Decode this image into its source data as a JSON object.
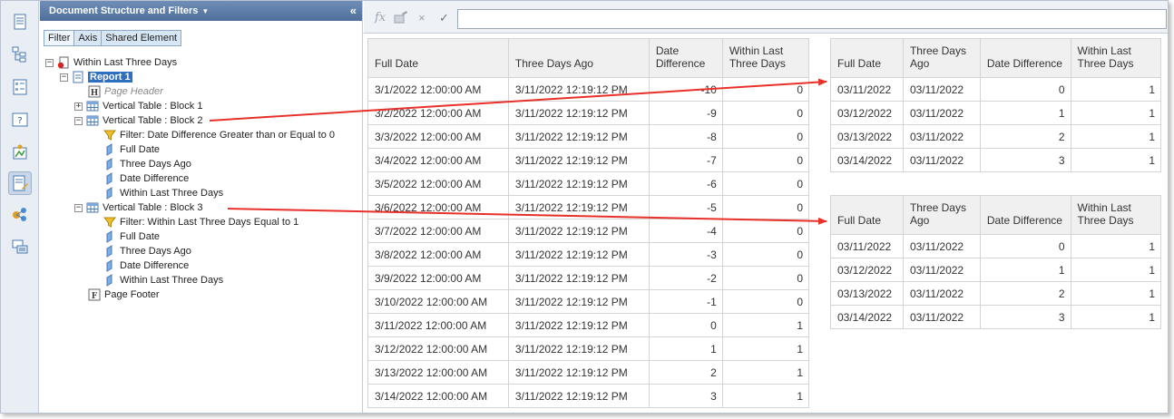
{
  "panel": {
    "title": "Document Structure and Filters",
    "collapse_glyph": "«",
    "tabs": [
      {
        "label": "Filter"
      },
      {
        "label": "Axis"
      },
      {
        "label": "Shared Element"
      }
    ]
  },
  "tree": {
    "document": "Within Last Three Days",
    "report": "Report 1",
    "page_header": "Page Header",
    "block1": "Vertical Table : Block 1",
    "block2": {
      "label": "Vertical Table : Block 2",
      "filter": "Filter: Date Difference Greater than or Equal to 0",
      "fields": [
        "Full Date",
        "Three Days Ago",
        "Date Difference",
        "Within Last Three Days"
      ]
    },
    "block3": {
      "label": "Vertical Table : Block 3",
      "filter": "Filter: Within Last Three Days Equal to 1",
      "fields": [
        "Full Date",
        "Three Days Ago",
        "Date Difference",
        "Within Last Three Days"
      ]
    },
    "page_footer": "Page Footer"
  },
  "formula_bar": {
    "fx_icon": "fx",
    "cancel_icon": "×",
    "confirm_icon": "✓",
    "value": ""
  },
  "main_table": {
    "headers": [
      "Full Date",
      "Three Days Ago",
      "Date Difference",
      "Within Last Three Days"
    ],
    "rows": [
      [
        "3/1/2022 12:00:00 AM",
        "3/11/2022 12:19:12 PM",
        "-10",
        "0"
      ],
      [
        "3/2/2022 12:00:00 AM",
        "3/11/2022 12:19:12 PM",
        "-9",
        "0"
      ],
      [
        "3/3/2022 12:00:00 AM",
        "3/11/2022 12:19:12 PM",
        "-8",
        "0"
      ],
      [
        "3/4/2022 12:00:00 AM",
        "3/11/2022 12:19:12 PM",
        "-7",
        "0"
      ],
      [
        "3/5/2022 12:00:00 AM",
        "3/11/2022 12:19:12 PM",
        "-6",
        "0"
      ],
      [
        "3/6/2022 12:00:00 AM",
        "3/11/2022 12:19:12 PM",
        "-5",
        "0"
      ],
      [
        "3/7/2022 12:00:00 AM",
        "3/11/2022 12:19:12 PM",
        "-4",
        "0"
      ],
      [
        "3/8/2022 12:00:00 AM",
        "3/11/2022 12:19:12 PM",
        "-3",
        "0"
      ],
      [
        "3/9/2022 12:00:00 AM",
        "3/11/2022 12:19:12 PM",
        "-2",
        "0"
      ],
      [
        "3/10/2022 12:00:00 AM",
        "3/11/2022 12:19:12 PM",
        "-1",
        "0"
      ],
      [
        "3/11/2022 12:00:00 AM",
        "3/11/2022 12:19:12 PM",
        "0",
        "1"
      ],
      [
        "3/12/2022 12:00:00 AM",
        "3/11/2022 12:19:12 PM",
        "1",
        "1"
      ],
      [
        "3/13/2022 12:00:00 AM",
        "3/11/2022 12:19:12 PM",
        "2",
        "1"
      ],
      [
        "3/14/2022 12:00:00 AM",
        "3/11/2022 12:19:12 PM",
        "3",
        "1"
      ]
    ]
  },
  "block2_table": {
    "headers": [
      "Full Date",
      "Three Days Ago",
      "Date Difference",
      "Within Last Three Days"
    ],
    "rows": [
      [
        "03/11/2022",
        "03/11/2022",
        "0",
        "1"
      ],
      [
        "03/12/2022",
        "03/11/2022",
        "1",
        "1"
      ],
      [
        "03/13/2022",
        "03/11/2022",
        "2",
        "1"
      ],
      [
        "03/14/2022",
        "03/11/2022",
        "3",
        "1"
      ]
    ]
  },
  "block3_table": {
    "headers": [
      "Full Date",
      "Three Days Ago",
      "Date Difference",
      "Within Last Three Days"
    ],
    "rows": [
      [
        "03/11/2022",
        "03/11/2022",
        "0",
        "1"
      ],
      [
        "03/12/2022",
        "03/11/2022",
        "1",
        "1"
      ],
      [
        "03/13/2022",
        "03/11/2022",
        "2",
        "1"
      ],
      [
        "03/14/2022",
        "03/11/2022",
        "3",
        "1"
      ]
    ]
  },
  "colors": {
    "annotation_arrow": "#e8302a",
    "panel_header": "#4f6f9b",
    "selection": "#2f6fbf"
  }
}
